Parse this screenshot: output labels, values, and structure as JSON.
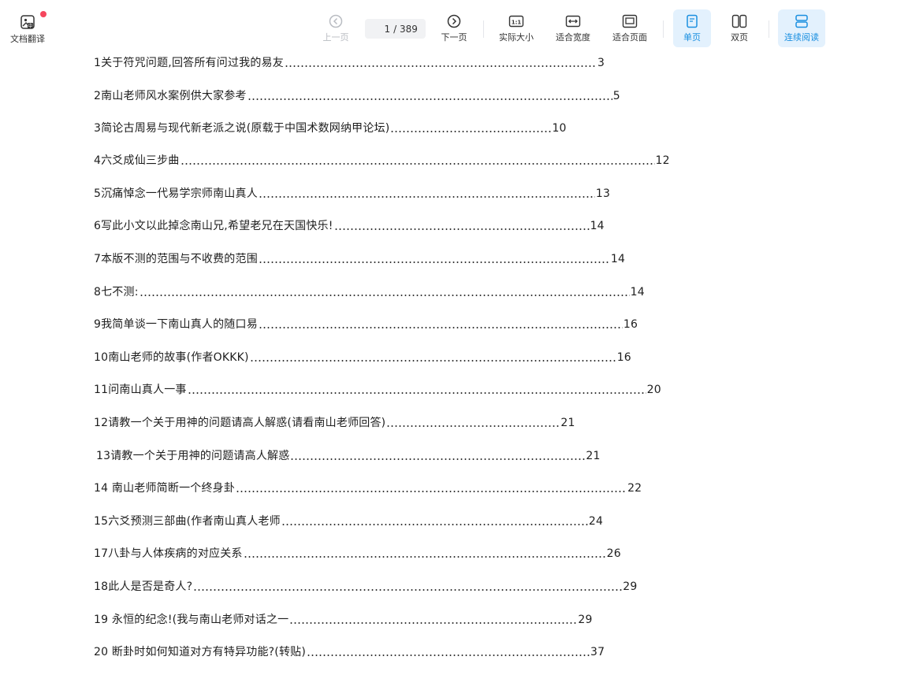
{
  "toolbar": {
    "translate_label": "文档翻译",
    "prev_label": "上一页",
    "current_page": "1",
    "total_pages": "/ 389",
    "next_label": "下一页",
    "actual_size_label": "实际大小",
    "fit_width_label": "适合宽度",
    "fit_page_label": "适合页面",
    "single_page_label": "单页",
    "double_page_label": "双页",
    "continuous_label": "连续阅读",
    "accent_color": "#1a8fe0",
    "badge_color": "#f5465d"
  },
  "toc": {
    "entries": [
      {
        "title": "1关于符咒问题,回答所有问过我的易友",
        "page": "3"
      },
      {
        "title": "2南山老师风水案例供大家参考",
        "page": "5"
      },
      {
        "title": "3简论古周易与现代新老派之说(原载于中国术数网纳甲论坛)",
        "page": "10"
      },
      {
        "title": "4六爻成仙三步曲",
        "page": "12"
      },
      {
        "title": "5沉痛悼念一代易学宗师南山真人",
        "page": "13"
      },
      {
        "title": "6写此小文以此掉念南山兄,希望老兄在天国快乐!",
        "page": "14"
      },
      {
        "title": "7本版不测的范围与不收费的范围",
        "page": "14"
      },
      {
        "title": "8七不测:",
        "page": "14"
      },
      {
        "title": "9我简单谈一下南山真人的随口易",
        "page": "16"
      },
      {
        "title": "10南山老师的故事(作者OKKK)",
        "page": "16"
      },
      {
        "title": "11问南山真人一事",
        "page": "20"
      },
      {
        "title": "12请教一个关于用神的问题请高人解惑(请看南山老师回答)",
        "page": "21"
      },
      {
        "title": "13请教一个关于用神的问题请高人解惑",
        "page": "21"
      },
      {
        "title": "14 南山老师简断一个终身卦",
        "page": "22"
      },
      {
        "title": "15六爻预测三部曲(作者南山真人老师",
        "page": "24"
      },
      {
        "title": "17八卦与人体疾病的对应关系",
        "page": "26"
      },
      {
        "title": "18此人是否是奇人?",
        "page": "29"
      },
      {
        "title": "19 永恒的纪念!(我与南山老师对话之一",
        "page": "29"
      },
      {
        "title": "20 断卦时如何知道对方有特异功能?(转贴)",
        "page": "37"
      }
    ]
  }
}
